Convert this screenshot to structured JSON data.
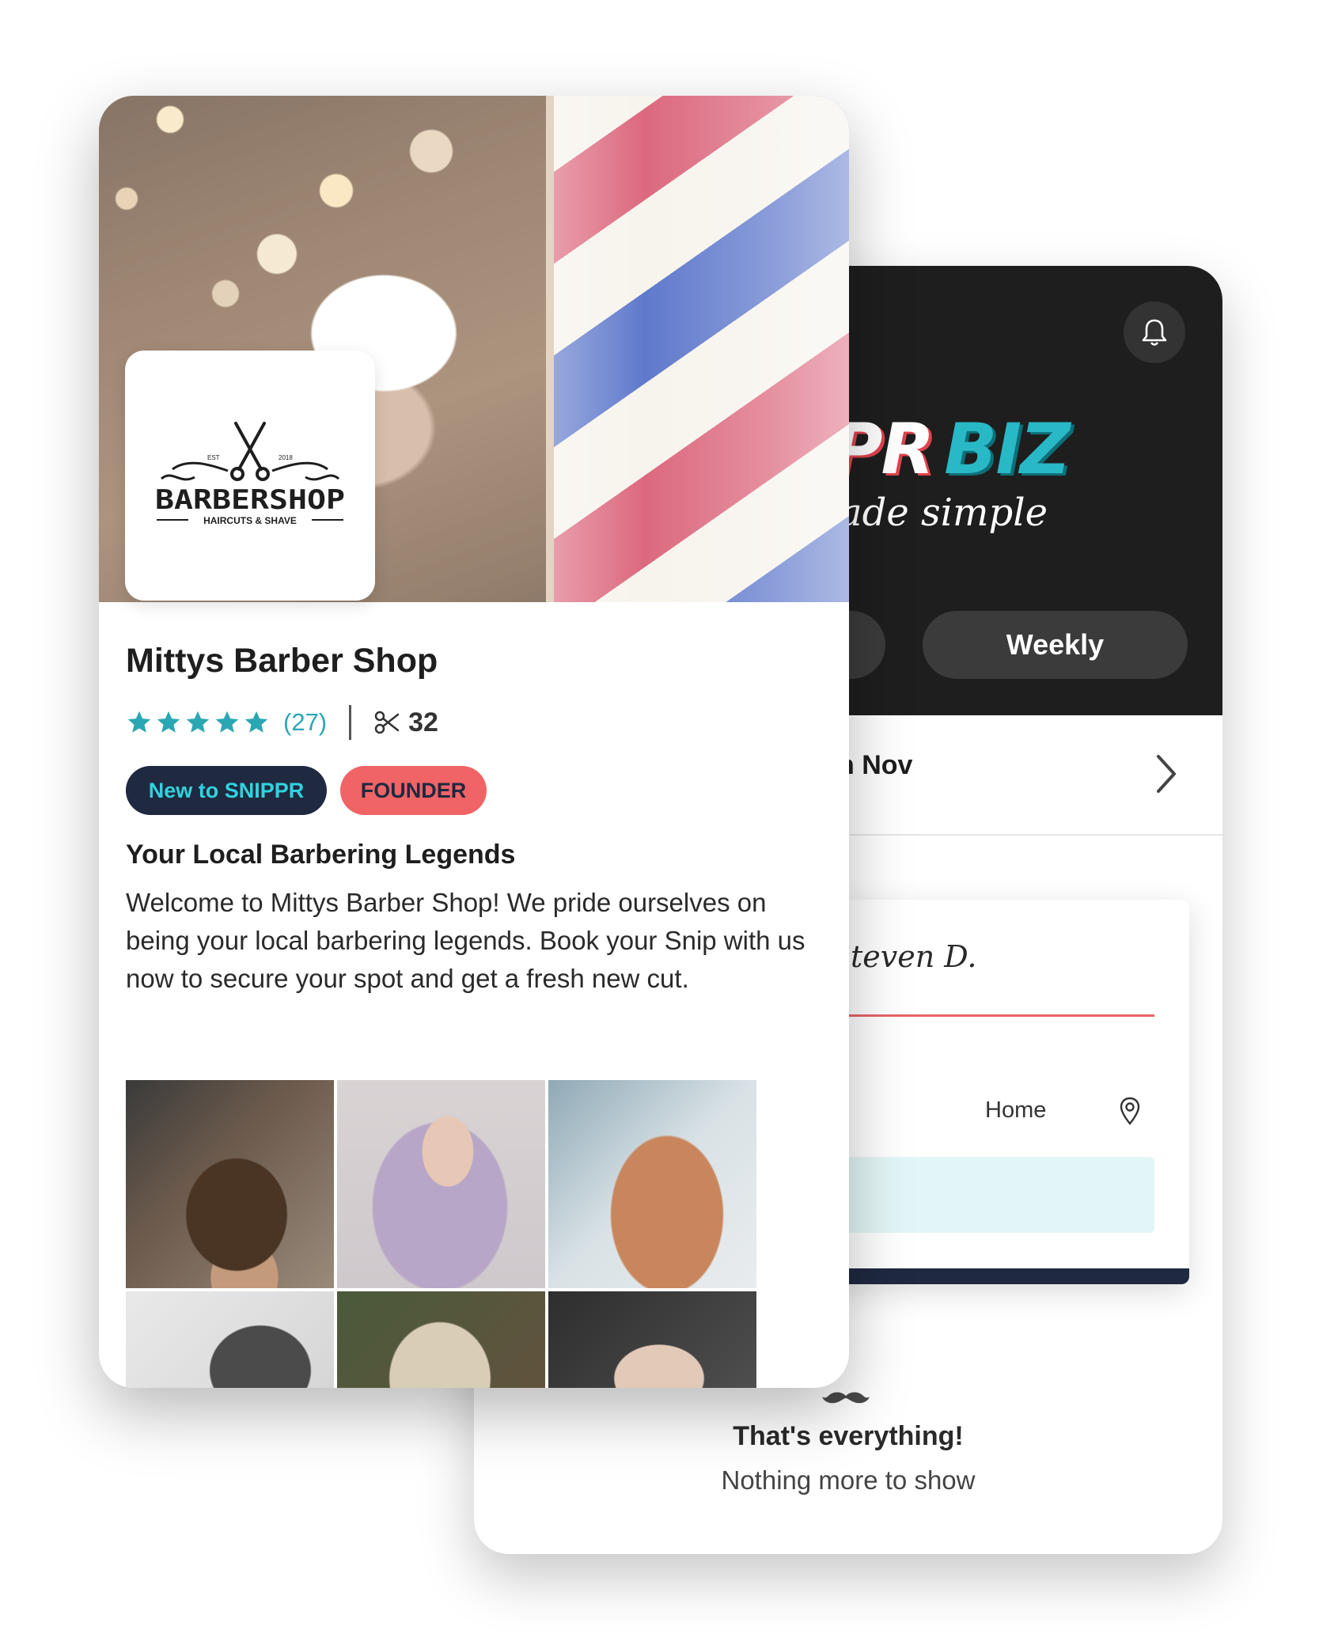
{
  "back_card": {
    "logo_part1": "PR",
    "logo_part2": "BIZ",
    "tagline": "ade simple",
    "toggle_weekly": "Weekly",
    "date_label": "h Nov",
    "booking": {
      "customer_name": "Steven D.",
      "location": "Home"
    },
    "end_title": "That's everything!",
    "end_subtitle": "Nothing more to show",
    "icons": [
      "bell-icon",
      "chevron-right-icon",
      "location-pin-icon",
      "mustache-icon"
    ]
  },
  "front_card": {
    "logo": {
      "brand": "BARBERSHOP",
      "sub": "HAIRCUTS & SHAVE",
      "est_left": "EST",
      "est_right": "2018"
    },
    "shop_name": "Mittys Barber Shop",
    "rating": {
      "stars": 5,
      "max": 5,
      "review_count": "(27)"
    },
    "snips": "32",
    "badges": {
      "new": "New to SNIPPR",
      "founder": "FOUNDER"
    },
    "section_heading": "Your Local Barbering Legends",
    "description": "Welcome to Mittys Barber Shop! We pride ourselves on being your local barbering legends. Book your Snip with us now to secure your spot and get a fresh new cut.",
    "gallery_count": 6
  },
  "colors": {
    "accent_teal": "#2aa7b3",
    "badge_navy": "#1f2940",
    "badge_coral": "#f06466",
    "dark_header": "#1e1e1e"
  }
}
